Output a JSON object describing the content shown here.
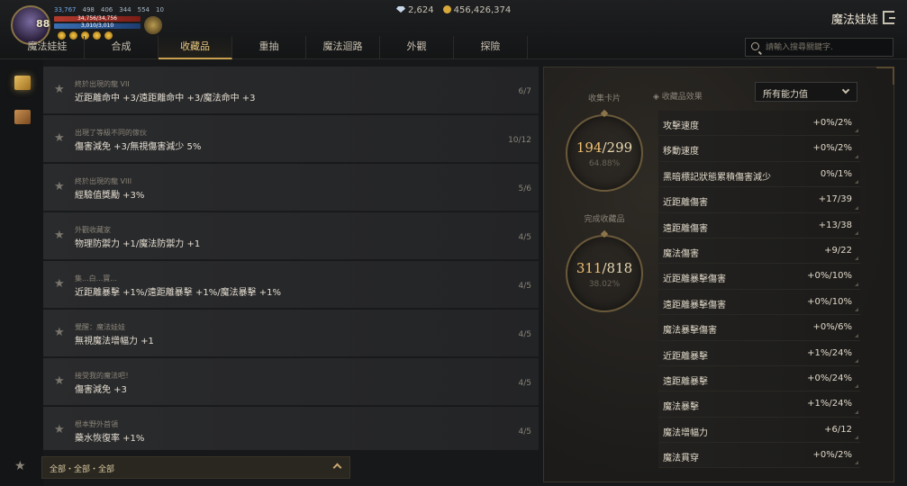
{
  "player": {
    "level": "88",
    "stat1": "33,767",
    "stat2": "498",
    "stat3": "406",
    "stat4": "344",
    "stat5": "554",
    "stat6": "10",
    "hp": "34,756/34,756",
    "mp": "3,010/3,010"
  },
  "currency": {
    "gems": "2,624",
    "gold": "456,426,374"
  },
  "character_name": "魔法娃娃",
  "tabs": [
    "魔法娃娃",
    "合成",
    "收藏品",
    "重抽",
    "魔法迴路",
    "外觀",
    "探險"
  ],
  "active_tab": "收藏品",
  "search": {
    "placeholder": "請輸入搜尋關鍵字."
  },
  "collections": [
    {
      "category": "終於出現的龍 VII",
      "effect": "近距離命中 +3/遠距離命中 +3/魔法命中 +3",
      "count": "6/7"
    },
    {
      "category": "出現了等級不同的傢伙",
      "effect": "傷害減免 +3/無視傷害減少 5%",
      "count": "10/12"
    },
    {
      "category": "終於出現的龍 VIII",
      "effect": "經驗值獎勵 +3%",
      "count": "5/6"
    },
    {
      "category": "外觀收藏家",
      "effect": "物理防禦力 +1/魔法防禦力 +1",
      "count": "4/5"
    },
    {
      "category": "集...白...寶...",
      "effect": "近距離暴擊 +1%/遠距離暴擊 +1%/魔法暴擊 +1%",
      "count": "4/5"
    },
    {
      "category": "覺醒：魔法娃娃",
      "effect": "無視魔法增幅力 +1",
      "count": "4/5"
    },
    {
      "category": "接受我的魔法吧！",
      "effect": "傷害減免 +3",
      "count": "4/5"
    },
    {
      "category": "根本野外首領",
      "effect": "藥水恢復率 +1%",
      "count": "4/5"
    }
  ],
  "filter": {
    "label": "全部・全部・全部"
  },
  "summary": {
    "cards_label": "收集卡片",
    "cards_current": "194",
    "cards_total": "/299",
    "cards_pct": "64.88%",
    "done_label": "完成收藏品",
    "done_current": "311",
    "done_total": "/818",
    "done_pct": "38.02%"
  },
  "effects_panel": {
    "title": "◈ 收藏品效果",
    "dropdown": "所有能力值",
    "rows": [
      {
        "name": "攻擊速度",
        "value": "+0%/2%"
      },
      {
        "name": "移動速度",
        "value": "+0%/2%"
      },
      {
        "name": "黑暗標記狀態累積傷害減少",
        "value": "0%/1%"
      },
      {
        "name": "近距離傷害",
        "value": "+17/39"
      },
      {
        "name": "遠距離傷害",
        "value": "+13/38"
      },
      {
        "name": "魔法傷害",
        "value": "+9/22"
      },
      {
        "name": "近距離暴擊傷害",
        "value": "+0%/10%"
      },
      {
        "name": "遠距離暴擊傷害",
        "value": "+0%/10%"
      },
      {
        "name": "魔法暴擊傷害",
        "value": "+0%/6%"
      },
      {
        "name": "近距離暴擊",
        "value": "+1%/24%"
      },
      {
        "name": "遠距離暴擊",
        "value": "+0%/24%"
      },
      {
        "name": "魔法暴擊",
        "value": "+1%/24%"
      },
      {
        "name": "魔法增幅力",
        "value": "+6/12"
      },
      {
        "name": "魔法貫穿",
        "value": "+0%/2%"
      }
    ]
  }
}
